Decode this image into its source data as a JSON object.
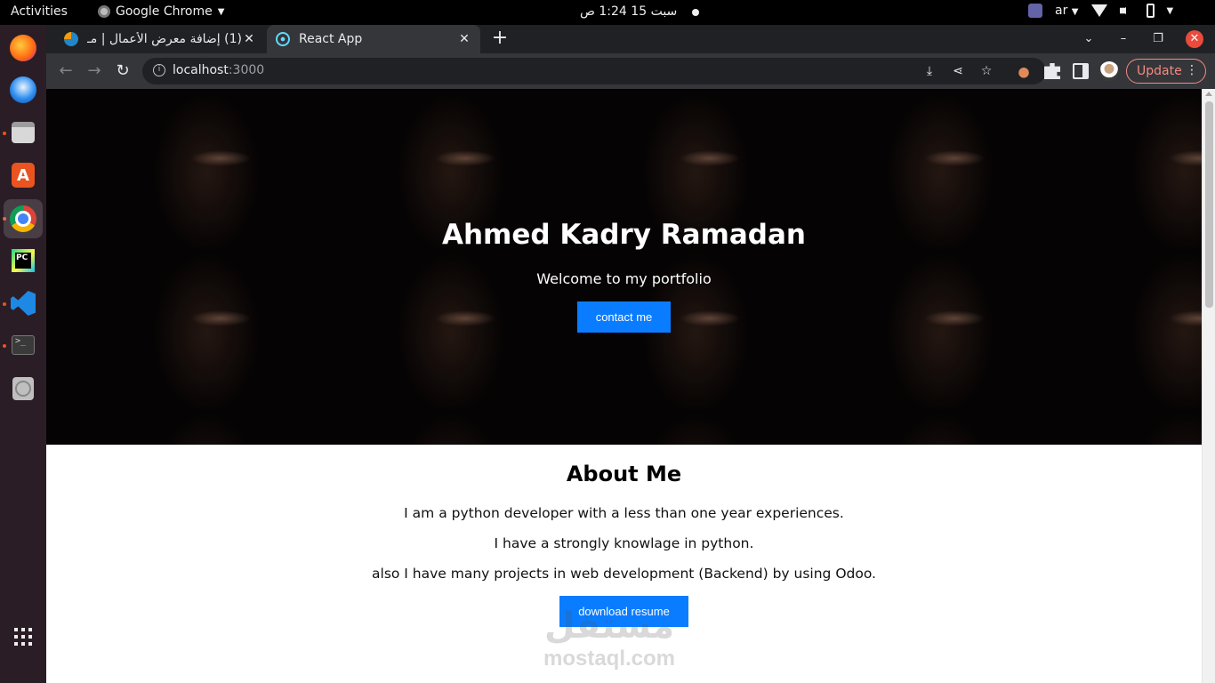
{
  "topbar": {
    "activities": "Activities",
    "app_name": "Google Chrome",
    "clock": "سبت 15  1:24 ص",
    "language": "ar"
  },
  "dock": {
    "items": [
      "firefox",
      "thunderbird",
      "files",
      "ubuntu-software",
      "google-chrome",
      "pycharm",
      "visual-studio-code",
      "terminal",
      "disc"
    ]
  },
  "browser": {
    "tabs": [
      {
        "title": "(1) إضافة معرض الأعمال | مـ",
        "favicon": "mostaql-favicon",
        "active": false
      },
      {
        "title": "React App",
        "favicon": "react-favicon",
        "active": true
      }
    ],
    "url_host": "localhost",
    "url_port": ":3000",
    "update_label": "Update"
  },
  "page": {
    "hero": {
      "name": "Ahmed Kadry Ramadan",
      "subtitle": "Welcome to my portfolio",
      "contact_button": "contact me"
    },
    "about": {
      "title": "About Me",
      "lines": [
        "I am a python developer with a less than one year experiences.",
        "I have a strongly knowlage in python.",
        "also I have many projects in web development (Backend) by using Odoo."
      ],
      "resume_button": "download resume"
    },
    "watermark": {
      "arabic": "مستقل",
      "latin": "mostaql.com"
    }
  },
  "colors": {
    "accent_button": "#0a7cff",
    "dock_bg": "#2b1d26",
    "ubuntu_orange": "#e95420"
  }
}
